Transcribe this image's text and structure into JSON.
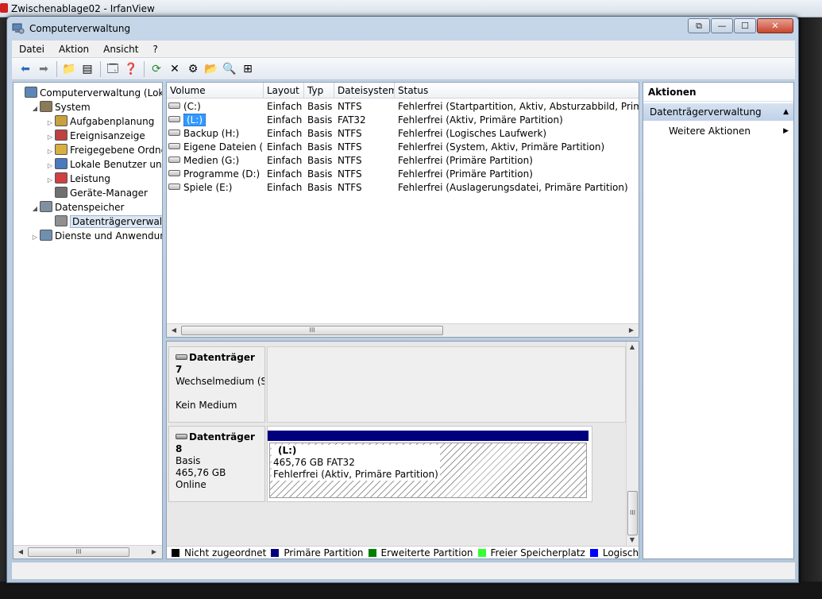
{
  "outer": {
    "title": "Zwischenablage02 - IrfanView"
  },
  "window": {
    "title": "Computerverwaltung",
    "controls": {
      "restore": "⧉",
      "minimize": "—",
      "maximize": "☐",
      "close": "✕"
    }
  },
  "menu": [
    "Datei",
    "Aktion",
    "Ansicht",
    "?"
  ],
  "toolbar": {
    "icons": [
      "back-icon",
      "forward-icon",
      "up-folder-icon",
      "show-tree-icon",
      "properties-icon",
      "help-icon",
      "refresh-icon",
      "delete-icon",
      "settings-icon",
      "open-icon",
      "search-icon",
      "wizard-icon"
    ],
    "glyphs": [
      "⬅",
      "➡",
      "📁",
      "▤",
      "🗔",
      "❓",
      "⟳",
      "✕",
      "⚙",
      "📂",
      "🔍",
      "⊞"
    ]
  },
  "tree": {
    "items": [
      {
        "label": "Computerverwaltung (Lokal)",
        "exp": "",
        "icon": "computer-icon",
        "indent": 0
      },
      {
        "label": "System",
        "exp": "◢",
        "icon": "tools-icon",
        "indent": 1
      },
      {
        "label": "Aufgabenplanung",
        "exp": "▷",
        "icon": "clock-icon",
        "indent": 2
      },
      {
        "label": "Ereignisanzeige",
        "exp": "▷",
        "icon": "event-viewer-icon",
        "indent": 2
      },
      {
        "label": "Freigegebene Ordner",
        "exp": "▷",
        "icon": "shared-folder-icon",
        "indent": 2
      },
      {
        "label": "Lokale Benutzer und Gru",
        "exp": "▷",
        "icon": "users-icon",
        "indent": 2
      },
      {
        "label": "Leistung",
        "exp": "▷",
        "icon": "performance-icon",
        "indent": 2
      },
      {
        "label": "Geräte-Manager",
        "exp": "",
        "icon": "device-manager-icon",
        "indent": 2
      },
      {
        "label": "Datenspeicher",
        "exp": "◢",
        "icon": "storage-icon",
        "indent": 1
      },
      {
        "label": "Datenträgerverwaltung",
        "exp": "",
        "icon": "disk-management-icon",
        "indent": 2,
        "selected": true
      },
      {
        "label": "Dienste und Anwendungen",
        "exp": "▷",
        "icon": "services-icon",
        "indent": 1
      }
    ]
  },
  "volumes": {
    "columns": [
      "Volume",
      "Layout",
      "Typ",
      "Dateisystem",
      "Status"
    ],
    "rows": [
      [
        "(C:)",
        "Einfach",
        "Basis",
        "NTFS",
        "Fehlerfrei (Startpartition, Aktiv, Absturzabbild, Primäre Pa"
      ],
      [
        "(L:)",
        "Einfach",
        "Basis",
        "FAT32",
        "Fehlerfrei (Aktiv, Primäre Partition)"
      ],
      [
        "Backup (H:)",
        "Einfach",
        "Basis",
        "NTFS",
        "Fehlerfrei (Logisches Laufwerk)"
      ],
      [
        "Eigene Dateien (F:)",
        "Einfach",
        "Basis",
        "NTFS",
        "Fehlerfrei (System, Aktiv, Primäre Partition)"
      ],
      [
        "Medien (G:)",
        "Einfach",
        "Basis",
        "NTFS",
        "Fehlerfrei (Primäre Partition)"
      ],
      [
        "Programme (D:)",
        "Einfach",
        "Basis",
        "NTFS",
        "Fehlerfrei (Primäre Partition)"
      ],
      [
        "Spiele (E:)",
        "Einfach",
        "Basis",
        "NTFS",
        "Fehlerfrei (Auslagerungsdatei, Primäre Partition)"
      ]
    ],
    "selected_index": 1
  },
  "disks": {
    "disk7": {
      "name": "Datenträger 7",
      "type": "Wechselmedium (S:",
      "status": "Kein Medium"
    },
    "disk8": {
      "name": "Datenträger 8",
      "type": "Basis",
      "size": "465,76 GB",
      "status": "Online",
      "partition": {
        "label": "(L:)",
        "size_fs": "465,76 GB FAT32",
        "status": "Fehlerfrei (Aktiv, Primäre Partition)"
      }
    }
  },
  "legend": [
    {
      "label": "Nicht zugeordnet",
      "color": "#000000"
    },
    {
      "label": "Primäre Partition",
      "color": "#00007f"
    },
    {
      "label": "Erweiterte Partition",
      "color": "#008000"
    },
    {
      "label": "Freier Speicherplatz",
      "color": "#33ff33"
    },
    {
      "label": "Logisches Laufwerk",
      "color": "#0000ff"
    }
  ],
  "actions": {
    "title": "Aktionen",
    "section": "Datenträgerverwaltung",
    "item": "Weitere Aktionen"
  },
  "scroll": {
    "grip": "III"
  },
  "colors": {
    "accent": "#3399ff",
    "primary_partition": "#00007f"
  }
}
